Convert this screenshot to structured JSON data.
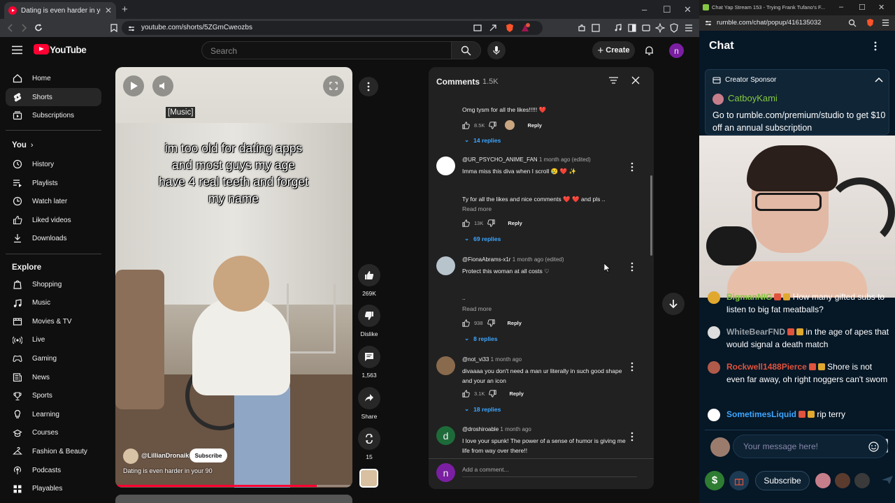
{
  "browser": {
    "tab_title": "Dating is even harder in your 9(",
    "url": "youtube.com/shorts/5ZGmCweozbs"
  },
  "youtube": {
    "logo": "YouTube",
    "search_placeholder": "Search",
    "create_label": "Create",
    "account_initial": "n"
  },
  "sidebar": {
    "main": [
      {
        "label": "Home",
        "icon": "home-icon"
      },
      {
        "label": "Shorts",
        "icon": "shorts-icon"
      },
      {
        "label": "Subscriptions",
        "icon": "subscriptions-icon"
      }
    ],
    "you_header": "You",
    "you": [
      {
        "label": "History",
        "icon": "history-icon"
      },
      {
        "label": "Playlists",
        "icon": "playlists-icon"
      },
      {
        "label": "Watch later",
        "icon": "watch-later-icon"
      },
      {
        "label": "Liked videos",
        "icon": "liked-icon"
      },
      {
        "label": "Downloads",
        "icon": "download-icon"
      }
    ],
    "explore_header": "Explore",
    "explore": [
      {
        "label": "Shopping",
        "icon": "shopping-icon"
      },
      {
        "label": "Music",
        "icon": "music-icon"
      },
      {
        "label": "Movies & TV",
        "icon": "movies-icon"
      },
      {
        "label": "Live",
        "icon": "live-icon"
      },
      {
        "label": "Gaming",
        "icon": "gaming-icon"
      },
      {
        "label": "News",
        "icon": "news-icon"
      },
      {
        "label": "Sports",
        "icon": "sports-icon"
      },
      {
        "label": "Learning",
        "icon": "learning-icon"
      },
      {
        "label": "Courses",
        "icon": "courses-icon"
      },
      {
        "label": "Fashion & Beauty",
        "icon": "fashion-icon"
      },
      {
        "label": "Podcasts",
        "icon": "podcasts-icon"
      },
      {
        "label": "Playables",
        "icon": "playables-icon"
      }
    ]
  },
  "video": {
    "music_tag": "[Music]",
    "caption": "im too old for dating apps and most guys my age have 4 real teeth and forget my name",
    "channel": "@LillianDronaik",
    "subscribe": "Subscribe",
    "title": "Dating is even harder in your 90",
    "progress": 0.85
  },
  "actions": {
    "likes": "269K",
    "dislike": "Dislike",
    "comments": "1,563",
    "share": "Share",
    "remix": "15"
  },
  "comments": {
    "title": "Comments",
    "count": "1.5K",
    "add_placeholder": "Add a comment...",
    "add_avatar": "n",
    "items": [
      {
        "text": "Omg tysm for all the likes!!!!! ❤️",
        "likes": "8.5K",
        "reply": "Reply",
        "replies": "14 replies"
      },
      {
        "user": "@UR_PSYCHO_ANIME_FAN",
        "time": "1 month ago (edited)",
        "text": "Imma miss this diva when I scroll 😢 ❤️ ✨",
        "text2": "Ty for all the likes and nice comments ❤️ ❤️  and pls ..",
        "read_more": "Read more",
        "likes": "13K",
        "reply": "Reply",
        "replies": "69 replies"
      },
      {
        "user": "@FionaAbrams-x1r",
        "time": "1 month ago (edited)",
        "text": "Protect this woman at all costs ♡",
        "text2": "..",
        "read_more": "Read more",
        "likes": "938",
        "reply": "Reply",
        "replies": "8 replies"
      },
      {
        "user": "@not_vi33",
        "time": "1 month ago",
        "text": "divaaaa you don't need a man ur literally in such good shape and your an icon",
        "likes": "3.1K",
        "reply": "Reply",
        "replies": "18 replies"
      },
      {
        "user": "@droshiroable",
        "time": "1 month ago",
        "avatar_letter": "d",
        "text": "I love your spunk!  The power of a sense of humor is giving me life from way over there!!"
      }
    ]
  },
  "rumble": {
    "tab_title": "Chat Yap Stream 153 - Trying Frank Tufano's F...",
    "url": "rumble.com/chat/popup/416135032",
    "chat_title": "Chat",
    "sponsor_label": "Creator Sponsor",
    "sponsor_name": "CatboyKami",
    "sponsor_msg": "Go to rumble.com/premium/studio to get $10 off an annual subscription",
    "messages": [
      {
        "name": "BigmanNIG",
        "color": "#85c742",
        "text": "How many gifted subs to listen to big fat meatballs?"
      },
      {
        "name": "WhiteBearFND",
        "color": "#9aa0a6",
        "text": "in the age of apes that would signal a death match"
      },
      {
        "name": "Rockwell1488Pierce",
        "color": "#e0533d",
        "text": "Shore is not even far away, oh right noggers can't swom"
      },
      {
        "name": "SometimesLiquid",
        "color": "#3ea6ff",
        "text": "rip terry"
      }
    ],
    "input_placeholder": "Your message here!",
    "subscribe": "Subscribe"
  }
}
